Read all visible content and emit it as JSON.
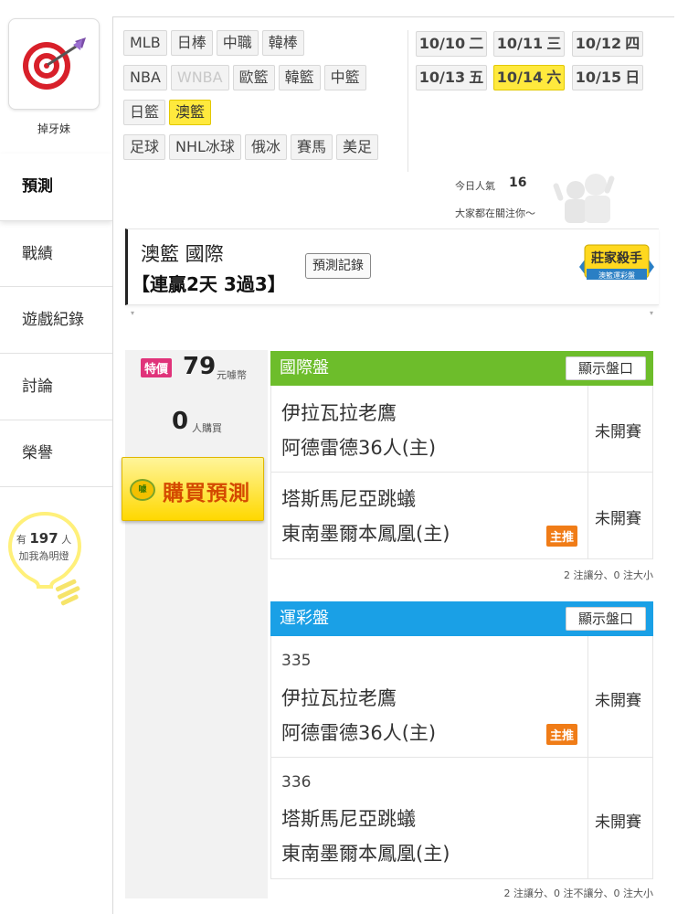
{
  "user": {
    "name": "掉牙妹"
  },
  "nav": [
    {
      "label": "預測"
    },
    {
      "label": "戰績"
    },
    {
      "label": "遊戲紀錄"
    },
    {
      "label": "討論"
    },
    {
      "label": "榮譽"
    }
  ],
  "fans": {
    "prefix": "有",
    "count": "197",
    "suffix": "人",
    "caption": "加我為明燈"
  },
  "leagues": {
    "row1": [
      "MLB",
      "日棒",
      "中職",
      "韓棒"
    ],
    "row2": [
      "NBA",
      "WNBA",
      "歐籃",
      "韓籃",
      "中籃"
    ],
    "row3": [
      "日籃",
      "澳籃"
    ],
    "row4": [
      "足球",
      "NHL冰球",
      "俄冰",
      "賽馬",
      "美足"
    ],
    "selected": "澳籃",
    "disabled": "WNBA"
  },
  "dates": [
    {
      "date": "10/10",
      "weekday": "二"
    },
    {
      "date": "10/11",
      "weekday": "三"
    },
    {
      "date": "10/12",
      "weekday": "四"
    },
    {
      "date": "10/13",
      "weekday": "五"
    },
    {
      "date": "10/14",
      "weekday": "六",
      "selected": true
    },
    {
      "date": "10/15",
      "weekday": "日"
    }
  ],
  "popularity": {
    "label": "今日人氣",
    "value": "16",
    "subtitle": "大家都在關注你～"
  },
  "header": {
    "title": "澳籃 國際",
    "streak": "【連贏2天 3過3】",
    "record_button": "預測記錄"
  },
  "badge": {
    "title": "莊家殺手",
    "subtitle": "澳籃運彩盤"
  },
  "pricing": {
    "tag": "特價",
    "price": "79",
    "unit": "元噱幣",
    "buyers": "0",
    "buyers_unit": "人購買",
    "buy_button": "購買預測",
    "buy_icon": "噱"
  },
  "intl_section": {
    "title": "國際盤",
    "show_button": "顯示盤口",
    "games": [
      {
        "away": "伊拉瓦拉老鷹",
        "home": "阿德雷德36人(主)",
        "status": "未開賽",
        "recommended": false
      },
      {
        "away": "塔斯馬尼亞跳蟻",
        "home": "東南墨爾本鳳凰(主)",
        "status": "未開賽",
        "recommended": true
      }
    ],
    "summary": "2 注讓分、0 注大小"
  },
  "lottery_section": {
    "title": "運彩盤",
    "show_button": "顯示盤口",
    "games": [
      {
        "no": "335",
        "away": "伊拉瓦拉老鷹",
        "home": "阿德雷德36人(主)",
        "status": "未開賽",
        "recommended": true
      },
      {
        "no": "336",
        "away": "塔斯馬尼亞跳蟻",
        "home": "東南墨爾本鳳凰(主)",
        "status": "未開賽",
        "recommended": false
      }
    ],
    "summary": "2 注讓分、0 注不讓分、0 注大小"
  },
  "recommend_label": "主推",
  "colors": {
    "accent_yellow": "#ffe93d",
    "intl_green": "#6dbd2b",
    "lottery_blue": "#1aa0e6",
    "recommend_orange": "#f07c17",
    "special_pink": "#e0337a"
  }
}
